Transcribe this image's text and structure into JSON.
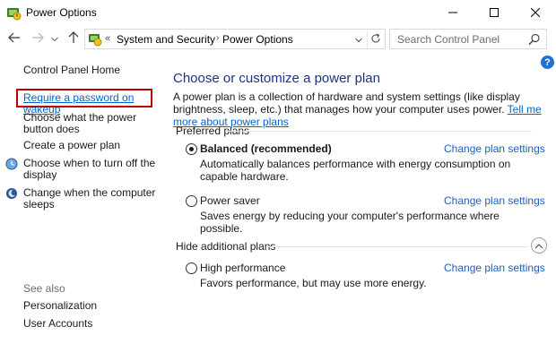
{
  "window": {
    "title": "Power Options",
    "icons": {
      "app": "power-options-icon",
      "minimize": "minimize-icon",
      "maximize": "maximize-icon",
      "close": "close-icon"
    }
  },
  "navigation": {
    "icons": {
      "back": "arrow-left-icon",
      "forward": "arrow-right-icon",
      "history": "chevron-down-icon",
      "up": "arrow-up-icon"
    },
    "address": {
      "overflow_chevron": "«",
      "crumbs": [
        "System and Security",
        "Power Options"
      ],
      "separator": "›",
      "icons": {
        "location": "control-panel-icon",
        "dropdown": "chevron-down-icon",
        "refresh": "refresh-icon"
      }
    },
    "search": {
      "placeholder": "Search Control Panel",
      "icon": "search-icon"
    }
  },
  "sidebar": {
    "home": "Control Panel Home",
    "links": [
      "Require a password on wakeup",
      "Choose what the power button does",
      "Create a power plan",
      "Choose when to turn off the display",
      "Change when the computer sleeps"
    ],
    "highlighted_link": "Require a password on wakeup",
    "see_also_label": "See also",
    "see_also": [
      "Personalization",
      "User Accounts"
    ]
  },
  "main": {
    "help": "?",
    "title": "Choose or customize a power plan",
    "intro": "A power plan is a collection of hardware and system settings (like display brightness, sleep, etc.) that manages how your computer uses power.",
    "intro_link": "Tell me more about power plans",
    "preferred_label": "Preferred plans",
    "hide_label": "Hide additional plans",
    "change_link": "Change plan settings",
    "plans": [
      {
        "name": "Balanced (recommended)",
        "selected": true,
        "description": "Automatically balances performance with energy consumption on capable hardware."
      },
      {
        "name": "Power saver",
        "selected": false,
        "description": "Saves energy by reducing your computer's performance where possible."
      },
      {
        "name": "High performance",
        "selected": false,
        "description": "Favors performance, but may use more energy."
      }
    ]
  },
  "colors": {
    "title_blue": "#1e3287",
    "link_blue": "#0066cc",
    "highlight_red": "#c00000",
    "help_blue": "#1f6fd6"
  }
}
